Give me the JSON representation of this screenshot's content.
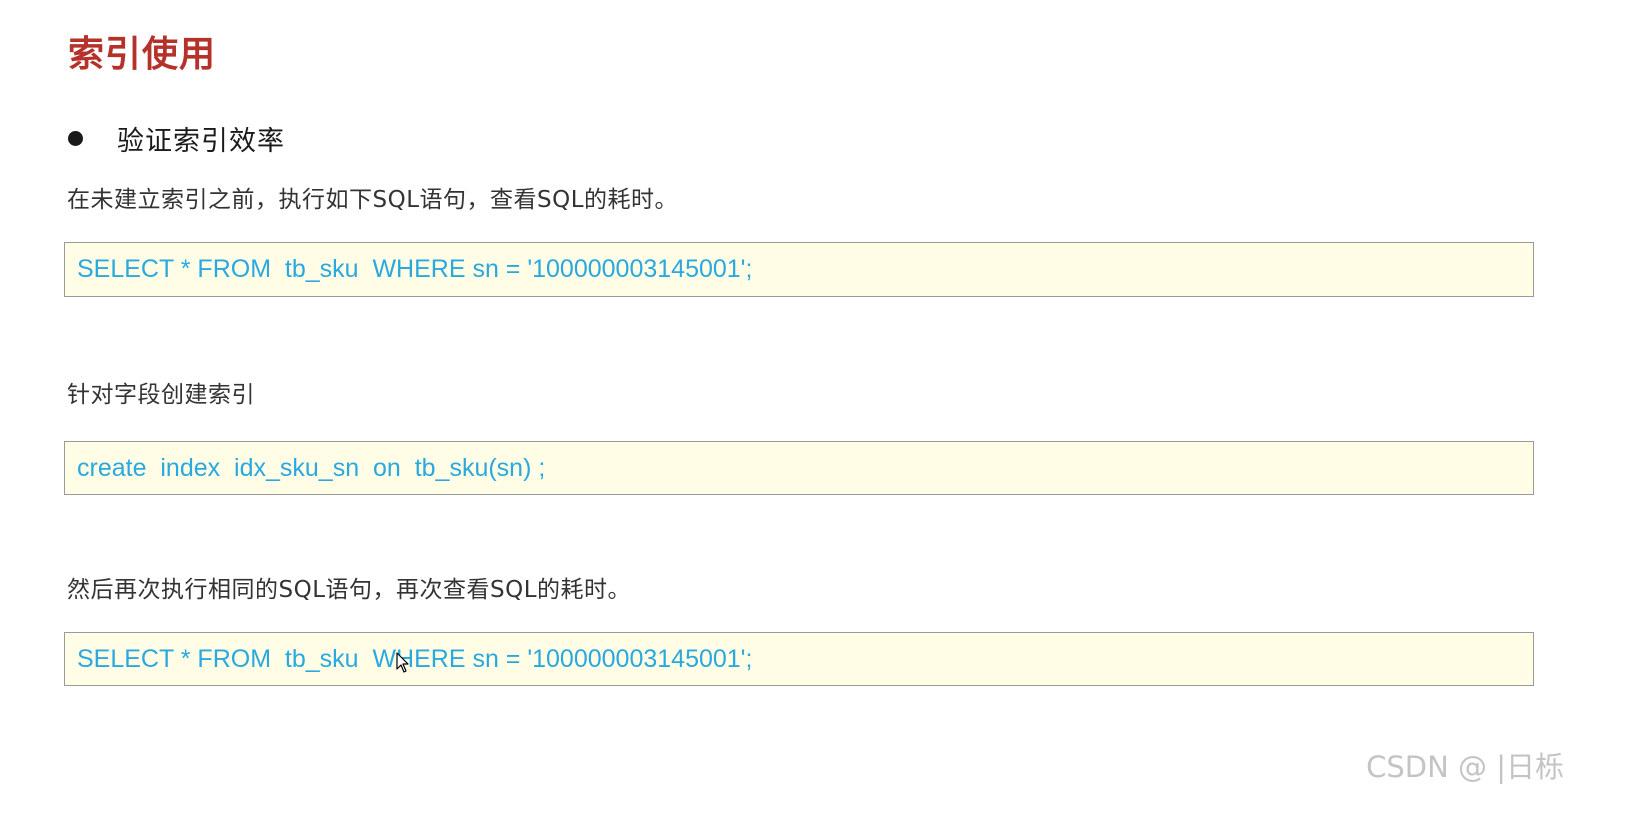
{
  "page": {
    "title": "索引使用",
    "bullet": "验证索引效率"
  },
  "steps": [
    {
      "description": "在未建立索引之前，执行如下SQL语句，查看SQL的耗时。",
      "code": "SELECT * FROM  tb_sku  WHERE sn = '100000003145001';"
    },
    {
      "description": "针对字段创建索引",
      "code": "create  index  idx_sku_sn  on  tb_sku(sn) ;"
    },
    {
      "description": "然后再次执行相同的SQL语句，再次查看SQL的耗时。",
      "code": "SELECT * FROM  tb_sku  WHERE sn = '100000003145001';"
    }
  ],
  "watermark": "CSDN @ |日栎",
  "icons": {
    "cursor": "mouse-pointer-icon"
  },
  "colors": {
    "title": "#b5322a",
    "code_text": "#2aa8e0",
    "code_background": "#fffde6"
  }
}
